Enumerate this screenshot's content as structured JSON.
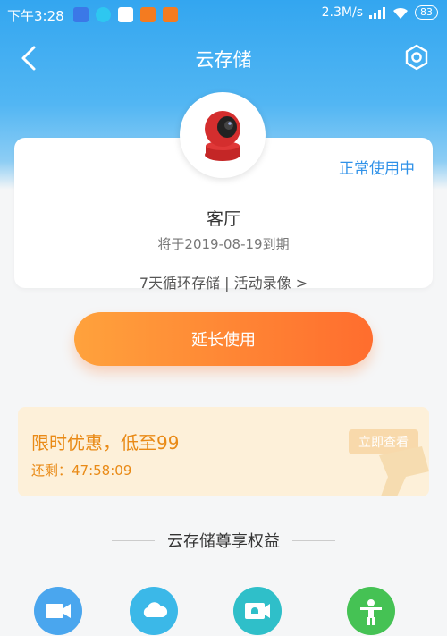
{
  "status_bar": {
    "time": "下午3:28",
    "network_speed": "2.3M/s",
    "battery": "83"
  },
  "nav": {
    "title": "云存储"
  },
  "device": {
    "status": "正常使用中",
    "name": "客厅",
    "expire": "将于2019-08-19到期",
    "plan": "7天循环存储 | 活动录像 >"
  },
  "actions": {
    "extend_label": "延长使用"
  },
  "promo": {
    "title": "限时优惠，低至99",
    "countdown": "还剩：47:58:09",
    "button": "立即查看"
  },
  "benefits": {
    "heading": "云存储尊享权益",
    "items": [
      {
        "icon": "cloud-video-icon",
        "color": "#4aa6ee"
      },
      {
        "icon": "cloud-drive-icon",
        "color": "#3bb8e8"
      },
      {
        "icon": "alarm-video-icon",
        "color": "#2fbfc9"
      },
      {
        "icon": "person-activity-icon",
        "color": "#45c254"
      }
    ]
  },
  "colors": {
    "primary": "#33a6f0",
    "accent_orange": "#ff7a30",
    "status_blue": "#2f91e8",
    "promo_text": "#e98a16"
  }
}
